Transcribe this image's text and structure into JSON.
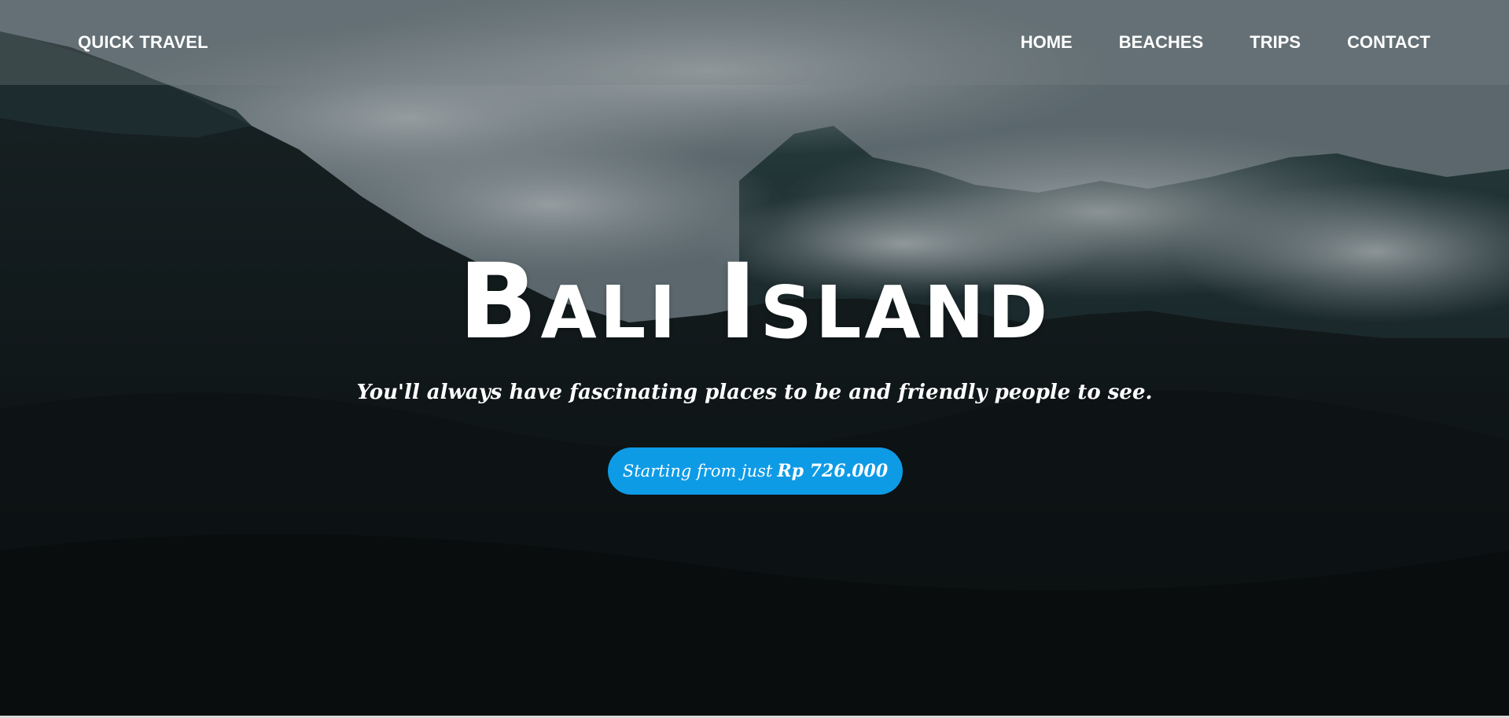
{
  "navbar": {
    "brand": "QUICK TRAVEL",
    "links": [
      {
        "label": "HOME"
      },
      {
        "label": "BEACHES"
      },
      {
        "label": "TRIPS"
      },
      {
        "label": "CONTACT"
      }
    ]
  },
  "hero": {
    "title": "Bali Island",
    "subtitle": "You'll always have fascinating places to be and friendly people to see.",
    "cta": {
      "prefix": "Starting from just",
      "price": "Rp 726.000"
    },
    "background": "misty-forest-mountains-image"
  },
  "colors": {
    "accent": "#0e9be6",
    "text": "#ffffff"
  }
}
